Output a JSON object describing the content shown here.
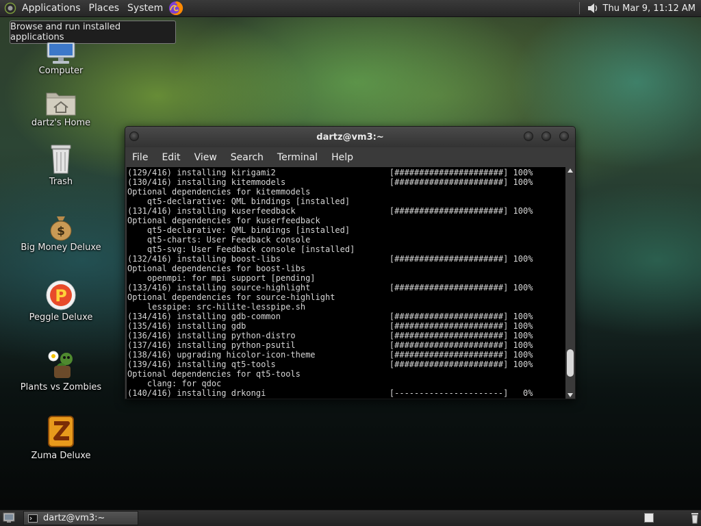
{
  "top_panel": {
    "menus": [
      "Applications",
      "Places",
      "System"
    ],
    "launcher_icon": "firefox-icon",
    "volume_icon": "speaker-icon",
    "clock": "Thu Mar  9, 11:12 AM"
  },
  "tooltip": {
    "text": "Browse and run installed applications"
  },
  "desktop_icons": [
    {
      "label": "Computer",
      "icon": "computer-icon"
    },
    {
      "label": "dartz's Home",
      "icon": "home-folder-icon"
    },
    {
      "label": "Trash",
      "icon": "trash-icon"
    },
    {
      "label": "Big Money Deluxe",
      "icon": "money-bag-icon"
    },
    {
      "label": "Peggle Deluxe",
      "icon": "peggle-icon"
    },
    {
      "label": "Plants vs Zombies",
      "icon": "plants-vs-zombies-icon"
    },
    {
      "label": "Zuma Deluxe",
      "icon": "zuma-icon"
    }
  ],
  "terminal": {
    "title": "dartz@vm3:~",
    "menu": [
      "File",
      "Edit",
      "View",
      "Search",
      "Terminal",
      "Help"
    ],
    "scroll_position": 0.92,
    "lines": [
      "(129/416) installing kirigami2                       [######################] 100%",
      "(130/416) installing kitemmodels                     [######################] 100%",
      "Optional dependencies for kitemmodels",
      "    qt5-declarative: QML bindings [installed]",
      "(131/416) installing kuserfeedback                   [######################] 100%",
      "Optional dependencies for kuserfeedback",
      "    qt5-declarative: QML bindings [installed]",
      "    qt5-charts: User Feedback console",
      "    qt5-svg: User Feedback console [installed]",
      "(132/416) installing boost-libs                      [######################] 100%",
      "Optional dependencies for boost-libs",
      "    openmpi: for mpi support [pending]",
      "(133/416) installing source-highlight                [######################] 100%",
      "Optional dependencies for source-highlight",
      "    lesspipe: src-hilite-lesspipe.sh",
      "(134/416) installing gdb-common                      [######################] 100%",
      "(135/416) installing gdb                             [######################] 100%",
      "(136/416) installing python-distro                   [######################] 100%",
      "(137/416) installing python-psutil                   [######################] 100%",
      "(138/416) upgrading hicolor-icon-theme               [######################] 100%",
      "(139/416) installing qt5-tools                       [######################] 100%",
      "Optional dependencies for qt5-tools",
      "    clang: for qdoc",
      "(140/416) installing drkongi                         [----------------------]   0%"
    ]
  },
  "bottom_panel": {
    "taskbar_item": "dartz@vm3:~",
    "show_desktop_icon": "show-desktop-icon",
    "trash_icon": "trash-applet-icon"
  }
}
